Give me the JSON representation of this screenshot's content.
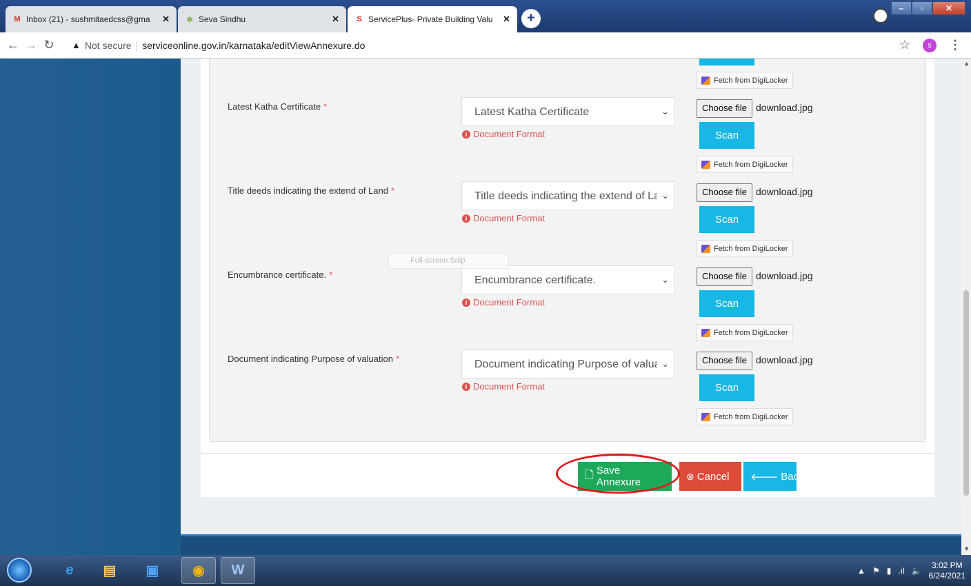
{
  "browser": {
    "tabs": [
      {
        "title": "Inbox (21) - sushmitaedcss@gma",
        "icon": "gmail-icon",
        "active": false
      },
      {
        "title": "Seva Sindhu",
        "icon": "seva-sindhu-icon",
        "active": false
      },
      {
        "title": "ServicePlus- Private Building Valu",
        "icon": "serviceplus-icon",
        "active": true
      }
    ],
    "new_tab": "+",
    "security": "Not secure",
    "url": "serviceonline.gov.in/karnataka/editViewAnnexure.do",
    "profile_initial": "s"
  },
  "documents": [
    {
      "label": "Latest Katha Certificate",
      "required": "*",
      "selected": "Latest Katha Certificate",
      "format": "Document Format",
      "choose": "Choose file",
      "file": "download.jpg",
      "scan": "Scan",
      "digilocker": "Fetch from DigiLocker"
    },
    {
      "label": "Title deeds indicating the extend of Land",
      "required": "*",
      "selected": "Title deeds indicating the extend of Lar",
      "format": "Document Format",
      "choose": "Choose file",
      "file": "download.jpg",
      "scan": "Scan",
      "digilocker": "Fetch from DigiLocker"
    },
    {
      "label": "Encumbrance certificate.",
      "required": "*",
      "selected": "Encumbrance certificate.",
      "format": "Document Format",
      "choose": "Choose file",
      "file": "download.jpg",
      "scan": "Scan",
      "digilocker": "Fetch from DigiLocker"
    },
    {
      "label": "Document indicating Purpose of valuation",
      "required": "*",
      "selected": "Document indicating Purpose of valua",
      "format": "Document Format",
      "choose": "Choose file",
      "file": "download.jpg",
      "scan": "Scan",
      "digilocker": "Fetch from DigiLocker"
    }
  ],
  "top_digilocker": "Fetch from DigiLocker",
  "snip_overlay": "Full-screen Snip",
  "actions": {
    "save": "Save Annexure",
    "cancel": "Cancel",
    "back": "Back"
  },
  "taskbar": {
    "time": "3:02 PM",
    "date": "6/24/2021"
  },
  "colors": {
    "sidebar": "#1f5c8f",
    "save": "#1ea95a",
    "cancel": "#dd4b39",
    "scan": "#17b7e6",
    "highlight": "#e31818"
  }
}
